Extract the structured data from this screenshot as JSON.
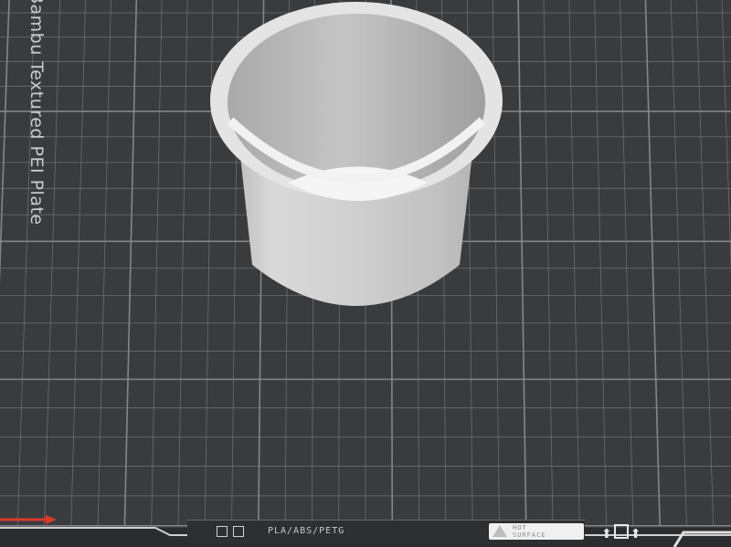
{
  "plate": {
    "name": "Bambu Textured PEI Plate",
    "material_compat": "PLA/ABS/PETG",
    "warning": [
      "HOT",
      "SURFACE"
    ]
  },
  "colors": {
    "background": "#3a3b3d",
    "grid_line": "#8c8e90",
    "model": "#d9d9d9",
    "x_axis": "#d93b2b"
  },
  "icons": [
    "plate-corner-icon",
    "qr-icon",
    "warning-triangle-icon",
    "arrow-up-icon",
    "square-icon"
  ],
  "model": {
    "type": "cup"
  }
}
